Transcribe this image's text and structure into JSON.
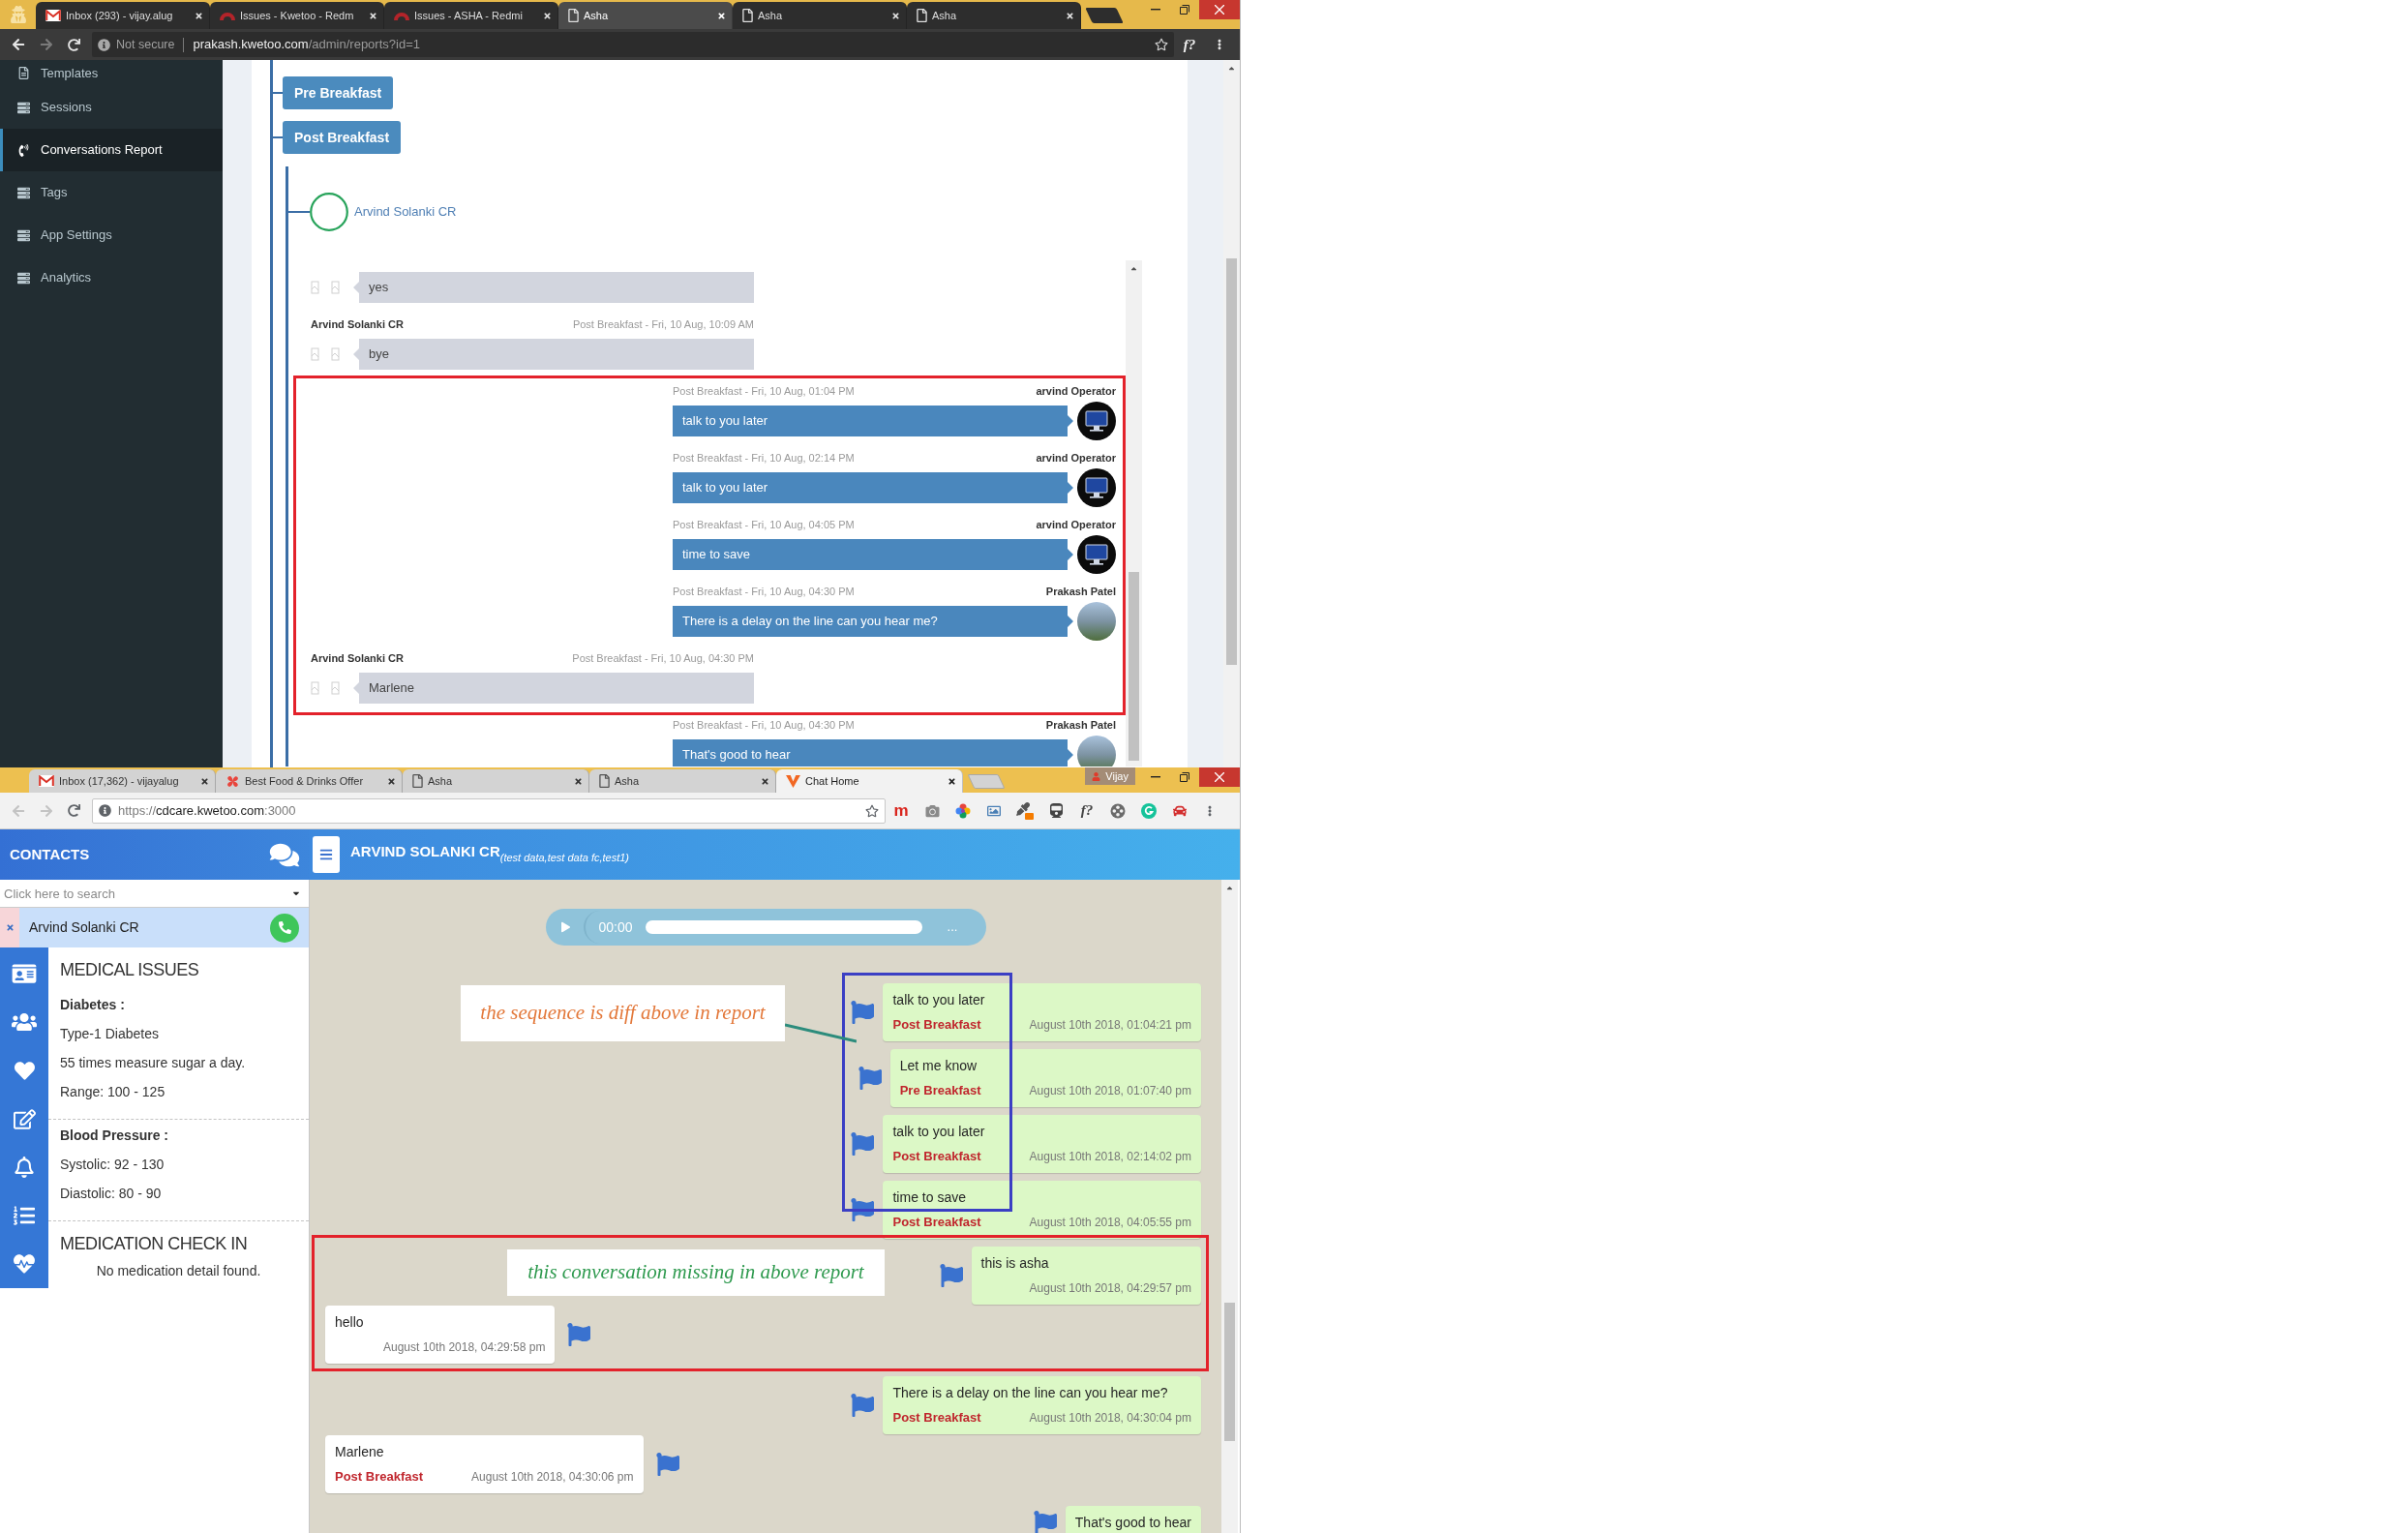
{
  "report_window": {
    "navigation": {
      "back_disabled": false,
      "forward_disabled": true
    },
    "tabs": [
      {
        "kind": "gmail",
        "title": "Inbox (293) - vijay.alug",
        "selected": false
      },
      {
        "kind": "redmine",
        "title": "Issues - Kwetoo - Redm",
        "selected": false
      },
      {
        "kind": "redmine",
        "title": "Issues - ASHA - Redmi",
        "selected": false
      },
      {
        "kind": "page",
        "title": "Asha",
        "selected": true
      },
      {
        "kind": "page",
        "title": "Asha",
        "selected": false
      },
      {
        "kind": "page",
        "title": "Asha",
        "selected": false
      }
    ],
    "address_bar": {
      "security": "Not secure",
      "host": "prakash.kwetoo.com",
      "suffix": "/admin/reports?id=1",
      "extension_texts": [
        "f?"
      ]
    },
    "sidebar": [
      {
        "kind": "template",
        "label": "Templates",
        "selected": false
      },
      {
        "kind": "list",
        "label": "Sessions",
        "selected": false
      },
      {
        "kind": "phone",
        "label": "Conversations Report",
        "selected": true
      },
      {
        "kind": "list",
        "label": "Tags",
        "selected": false
      },
      {
        "kind": "list",
        "label": "App Settings",
        "selected": false
      },
      {
        "kind": "list",
        "label": "Analytics",
        "selected": false
      }
    ],
    "sessions": [
      {
        "label": "Pre Breakfast"
      },
      {
        "label": "Post Breakfast",
        "children": [
          {
            "name": "Arvind Solanki CR",
            "messages": [
              {
                "kind": "patient",
                "text": "yes",
                "highlighted": false
              },
              {
                "kind": "patient",
                "sender": "Arvind Solanki CR",
                "time": "Post Breakfast - Fri, 10 Aug, 10:09 AM",
                "text": "bye",
                "highlighted": false
              },
              {
                "kind": "operator",
                "sender": "arvind Operator",
                "time": "Post Breakfast - Fri, 10 Aug, 01:04 PM",
                "text": "talk to you later",
                "highlighted": true
              },
              {
                "kind": "operator",
                "sender": "arvind Operator",
                "time": "Post Breakfast - Fri, 10 Aug, 02:14 PM",
                "text": "talk to you later",
                "highlighted": true
              },
              {
                "kind": "operator",
                "sender": "arvind Operator",
                "time": "Post Breakfast - Fri, 10 Aug, 04:05 PM",
                "text": "time to save",
                "highlighted": true
              },
              {
                "kind": "staff",
                "sender": "Prakash Patel",
                "time": "Post Breakfast - Fri, 10 Aug, 04:30 PM",
                "text": "There is a delay on the line can you hear me?",
                "highlighted": true
              },
              {
                "kind": "patient",
                "sender": "Arvind Solanki CR",
                "time": "Post Breakfast - Fri, 10 Aug, 04:30 PM",
                "text": "Marlene",
                "highlighted": true
              },
              {
                "kind": "staff",
                "sender": "Prakash Patel",
                "time": "Post Breakfast - Fri, 10 Aug, 04:30 PM",
                "text": "That's good to hear",
                "highlighted": false
              }
            ]
          }
        ]
      }
    ]
  },
  "chat_window": {
    "navigation": {
      "back_disabled": true,
      "forward_disabled": true
    },
    "tabs": [
      {
        "kind": "gmail",
        "title": "Inbox (17,362) - vijayalug",
        "selected": false
      },
      {
        "kind": "food",
        "title": "Best Food & Drinks Offer",
        "selected": false
      },
      {
        "kind": "page",
        "title": "Asha",
        "selected": false
      },
      {
        "kind": "page",
        "title": "Asha",
        "selected": false
      },
      {
        "kind": "chevron",
        "title": "Chat Home",
        "selected": true
      }
    ],
    "user_chip": "Vijay",
    "address_bar": {
      "scheme": "https://",
      "host": "cdcare.kwetoo.com",
      "suffix": ":3000",
      "extension_texts": [
        "m",
        "f?"
      ]
    },
    "contacts": {
      "title": "CONTACTS",
      "search_placeholder": "Click here to search",
      "items": [
        {
          "name": "Arvind Solanki CR",
          "selected": true
        }
      ]
    },
    "patient_details": {
      "sections": [
        {
          "title": "MEDICAL ISSUES",
          "groups": [
            {
              "heading": "Diabetes :",
              "lines": [
                "Type-1 Diabetes",
                "55 times measure sugar a day.",
                "Range: 100 - 125"
              ]
            },
            {
              "heading": "Blood Pressure :",
              "lines": [
                "Systolic: 92 - 130",
                "Diastolic: 80 - 90"
              ]
            }
          ]
        },
        {
          "title": "MEDICATION CHECK IN",
          "empty_text": "No medication detail found."
        }
      ]
    },
    "conversation": {
      "title": "ARVIND SOLANKI CR",
      "subtitle": "(test data,test data fc,test1)",
      "audio": {
        "time": "00:00",
        "more": "..."
      },
      "messages": [
        {
          "kind": "outgoing",
          "text": "talk to you later",
          "session": "Post Breakfast",
          "time": "August 10th 2018, 01:04:21 pm"
        },
        {
          "kind": "outgoing",
          "text": "Let me know",
          "session": "Pre Breakfast",
          "time": "August 10th 2018, 01:07:40 pm"
        },
        {
          "kind": "outgoing",
          "text": "talk to you later",
          "session": "Post Breakfast",
          "time": "August 10th 2018, 02:14:02 pm"
        },
        {
          "kind": "outgoing",
          "text": "time to save",
          "session": "Post Breakfast",
          "time": "August 10th 2018, 04:05:55 pm"
        },
        {
          "kind": "outgoing",
          "text": "this is asha",
          "time": "August 10th 2018, 04:29:57 pm"
        },
        {
          "kind": "incoming",
          "text": "hello",
          "time": "August 10th 2018, 04:29:58 pm"
        },
        {
          "kind": "outgoing",
          "text": "There is a delay on the line can you hear me?",
          "session": "Post Breakfast",
          "time": "August 10th 2018, 04:30:04 pm"
        },
        {
          "kind": "incoming",
          "text": "Marlene",
          "session": "Post Breakfast",
          "time": "August 10th 2018, 04:30:06 pm"
        },
        {
          "kind": "outgoing",
          "text": "That's good to hear"
        }
      ],
      "annotations": [
        {
          "kind": "box",
          "color": "#3b3fc4"
        },
        {
          "kind": "box",
          "color": "#e3222b"
        },
        {
          "kind": "note",
          "text": "the sequence is diff above in report",
          "color": "#e3783a"
        },
        {
          "kind": "leader",
          "color": "#2c8c7c"
        },
        {
          "kind": "note",
          "text": "this conversation missing in above report",
          "color": "#2f9a4f"
        }
      ]
    }
  }
}
